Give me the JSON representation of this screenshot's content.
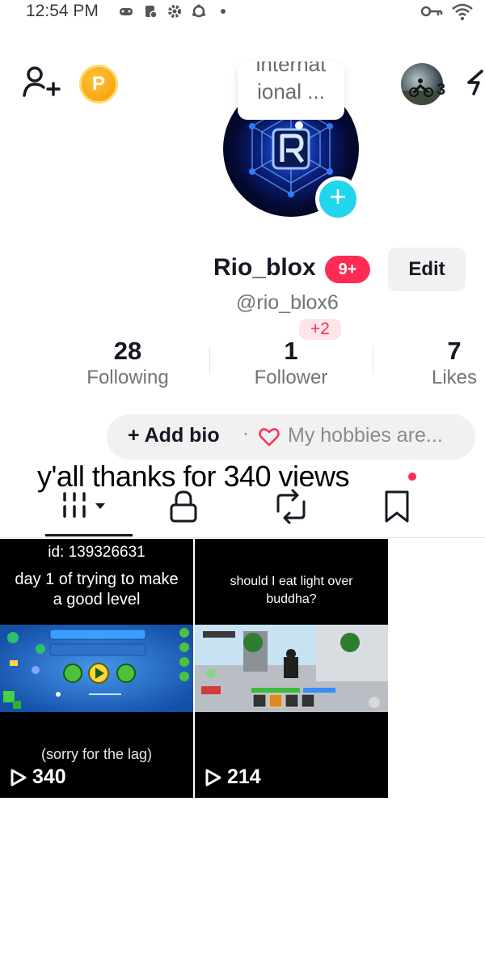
{
  "status_bar": {
    "time": "12:54 PM"
  },
  "top_bar": {
    "points_label": "P",
    "friends_count": "3"
  },
  "note": {
    "line1": "internat",
    "line2": "ional ..."
  },
  "profile": {
    "username": "Rio_blox",
    "notification_badge": "9+",
    "edit_label": "Edit",
    "handle": "@rio_blox6",
    "follower_delta": "+2"
  },
  "stats": [
    {
      "value": "28",
      "label": "Following"
    },
    {
      "value": "1",
      "label": "Follower"
    },
    {
      "value": "7",
      "label": "Likes"
    }
  ],
  "bio": {
    "add_bio_label": "+ Add bio",
    "separator": "·",
    "hobbies_prompt": "My hobbies are..."
  },
  "caption": "y'all thanks for 340 views",
  "videos": [
    {
      "id_line": "id: 139326631",
      "title": "day 1 of trying to make a good level",
      "footer_text": "(sorry for the lag)",
      "play_count": "340"
    },
    {
      "id_line": "",
      "title": "should I eat light over buddha?",
      "footer_text": "",
      "play_count": "214"
    }
  ],
  "colors": {
    "accent_pink": "#fe2c55",
    "accent_cyan": "#20d5ec",
    "points_gold": "#f59b00",
    "text_primary": "#161823",
    "text_secondary": "#737373"
  }
}
